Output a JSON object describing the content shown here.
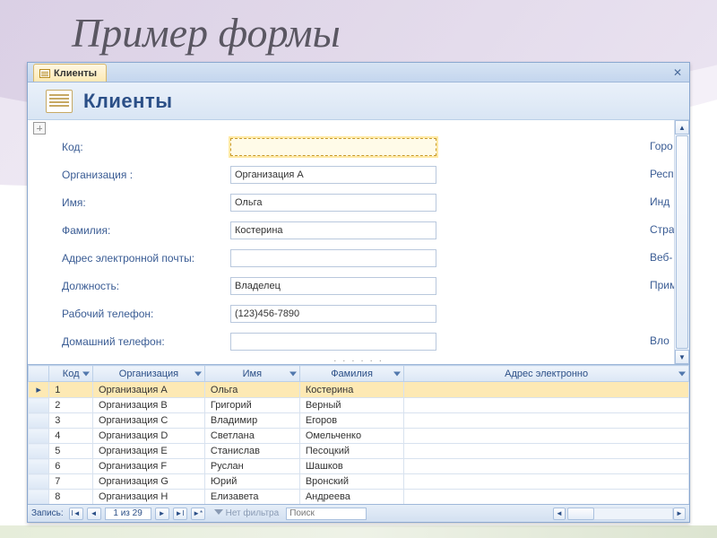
{
  "slide_title": "Пример  формы",
  "tab": {
    "label": "Клиенты"
  },
  "header": {
    "title": "Клиенты"
  },
  "fields": {
    "rows": [
      {
        "label": "Код:",
        "value": "",
        "focused": true
      },
      {
        "label": "Организация :",
        "value": "Организация А",
        "focused": false
      },
      {
        "label": "Имя:",
        "value": "Ольга",
        "focused": false
      },
      {
        "label": "Фамилия:",
        "value": "Костерина",
        "focused": false
      },
      {
        "label": "Адрес электронной почты:",
        "value": "",
        "focused": false
      },
      {
        "label": "Должность:",
        "value": "Владелец",
        "focused": false
      },
      {
        "label": "Рабочий телефон:",
        "value": "(123)456-7890",
        "focused": false
      },
      {
        "label": "Домашний телефон:",
        "value": "",
        "focused": false
      }
    ],
    "right_labels": [
      "Горо",
      "Респ",
      "Инд",
      "Стра",
      "Веб-",
      "Прим",
      "",
      "Вло"
    ]
  },
  "datasheet": {
    "columns": [
      "Код",
      "Организация",
      "Имя",
      "Фамилия",
      "Адрес электронно"
    ],
    "rows": [
      {
        "n": "1",
        "org": "Организация А",
        "first": "Ольга",
        "last": "Костерина",
        "email": ""
      },
      {
        "n": "2",
        "org": "Организация В",
        "first": "Григорий",
        "last": "Верный",
        "email": ""
      },
      {
        "n": "3",
        "org": "Организация С",
        "first": "Владимир",
        "last": "Егоров",
        "email": ""
      },
      {
        "n": "4",
        "org": "Организация D",
        "first": "Светлана",
        "last": "Омельченко",
        "email": ""
      },
      {
        "n": "5",
        "org": "Организация Е",
        "first": "Станислав",
        "last": "Песоцкий",
        "email": ""
      },
      {
        "n": "6",
        "org": "Организация F",
        "first": "Руслан",
        "last": "Шашков",
        "email": ""
      },
      {
        "n": "7",
        "org": "Организация G",
        "first": "Юрий",
        "last": "Вронский",
        "email": ""
      },
      {
        "n": "8",
        "org": "Организация Н",
        "first": "Елизавета",
        "last": "Андреева",
        "email": ""
      }
    ]
  },
  "nav": {
    "label": "Запись:",
    "position": "1 из 29",
    "filter_label": "Нет фильтра",
    "search_placeholder": "Поиск"
  }
}
